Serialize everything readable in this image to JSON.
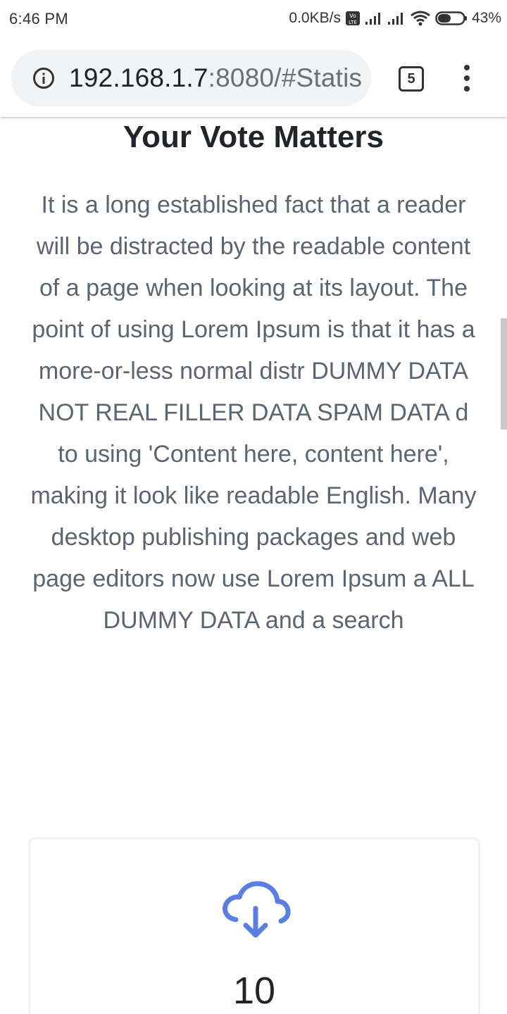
{
  "status_bar": {
    "time": "6:46 PM",
    "network_speed": "0.0KB/s",
    "volte_badge": "Vo LTE",
    "battery": "43%",
    "icons": [
      "volte-icon",
      "signal-icon",
      "signal-icon",
      "wifi-icon",
      "battery-icon"
    ]
  },
  "browser": {
    "url_host": "192.168.1.7",
    "url_rest": ":8080/#Statis",
    "tab_count": "5",
    "icons": [
      "info-icon",
      "tabs-icon",
      "more-vert-icon"
    ]
  },
  "page": {
    "heading": "Your Vote Matters",
    "body": "It is a long established fact that a reader will be distracted by the readable content of a page when looking at its layout. The point of using Lorem Ipsum is that it has a more-or-less normal distr DUMMY DATA NOT REAL FILLER DATA SPAM DATA d to using 'Content here, content here', making it look like readable English. Many desktop publishing packages and web page editors now use Lorem Ipsum a ALL DUMMY DATA and a search",
    "stat_card": {
      "icon": "cloud-download-icon",
      "value": "10",
      "accent_color": "#5b7fe0"
    }
  }
}
